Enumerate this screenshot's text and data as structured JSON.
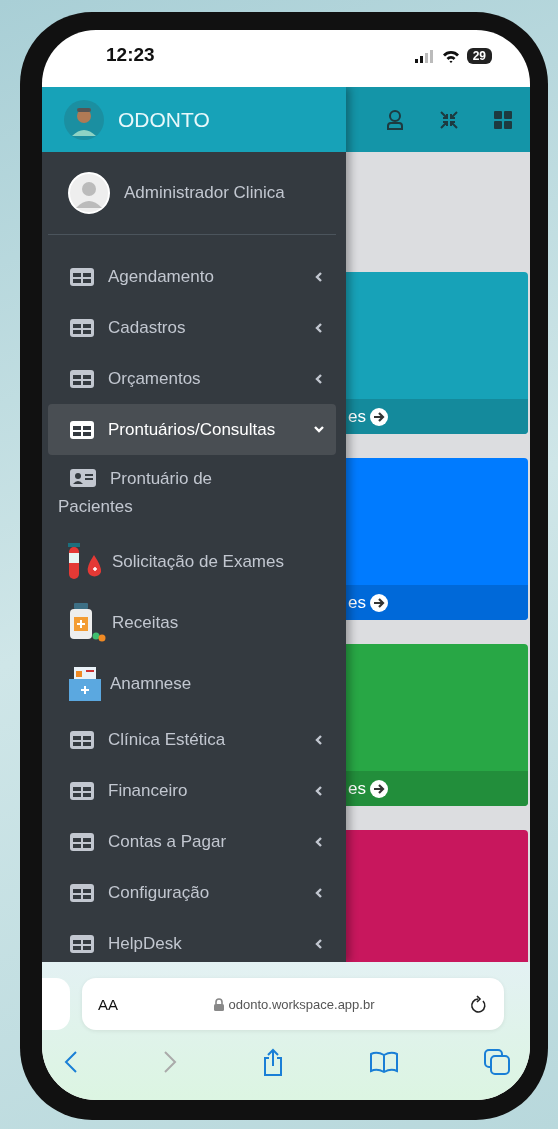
{
  "status_bar": {
    "time": "12:23",
    "battery": "29"
  },
  "sidebar": {
    "brand": "ODONTO",
    "user": "Administrador Clinica",
    "items": [
      {
        "label": "Agendamento",
        "kind": "group",
        "selected": false,
        "expanded": false
      },
      {
        "label": "Cadastros",
        "kind": "group",
        "selected": false,
        "expanded": false
      },
      {
        "label": "Orçamentos",
        "kind": "group",
        "selected": false,
        "expanded": false
      },
      {
        "label": "Prontuários/Consultas",
        "kind": "group",
        "selected": true,
        "expanded": true
      },
      {
        "label": "Prontuário de Pacientes",
        "kind": "id-card",
        "selected": false
      },
      {
        "label": "Solicitação de Exames",
        "kind": "exams",
        "selected": false
      },
      {
        "label": "Receitas",
        "kind": "prescription",
        "selected": false
      },
      {
        "label": "Anamnese",
        "kind": "anamnesis",
        "selected": false
      },
      {
        "label": "Clínica Estética",
        "kind": "group",
        "selected": false,
        "expanded": false
      },
      {
        "label": "Financeiro",
        "kind": "group",
        "selected": false,
        "expanded": false
      },
      {
        "label": "Contas a Pagar",
        "kind": "group",
        "selected": false,
        "expanded": false
      },
      {
        "label": "Configuração",
        "kind": "group",
        "selected": false,
        "expanded": false
      },
      {
        "label": "HelpDesk",
        "kind": "group",
        "selected": false,
        "expanded": false
      }
    ]
  },
  "cards": [
    {
      "color": "#17a2b8",
      "footer": "es"
    },
    {
      "color": "#007bff",
      "footer": "es"
    },
    {
      "color": "#28a745",
      "footer": "es"
    },
    {
      "color": "#c8175d"
    }
  ],
  "browser": {
    "text_size": "AA",
    "url": "odonto.workspace.app.br"
  }
}
